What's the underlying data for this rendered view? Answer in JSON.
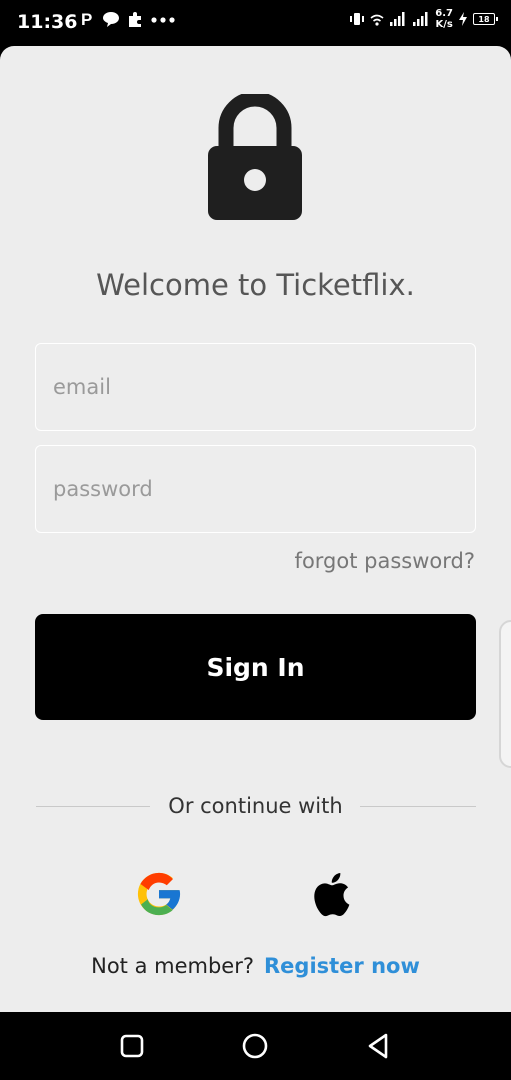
{
  "status_bar": {
    "time": "11:36",
    "left_icons": [
      "parking-icon",
      "chat-bubble-icon",
      "puzzle-icon",
      "more-dots-icon"
    ],
    "right_icons": [
      "vibrate-icon",
      "wifi-icon",
      "signal-icon",
      "signal-icon",
      "charging-icon"
    ],
    "net_speed_value": "6.7",
    "net_speed_unit": "K/s",
    "battery_level": "18"
  },
  "header": {
    "icon": "lock-icon",
    "welcome_text": "Welcome to Ticketflix."
  },
  "form": {
    "email_placeholder": "email",
    "email_value": "",
    "password_placeholder": "password",
    "password_value": "",
    "forgot_password_label": "forgot password?",
    "sign_in_label": "Sign In"
  },
  "social": {
    "continue_label": "Or continue with",
    "providers": [
      "google-icon",
      "apple-icon"
    ]
  },
  "footer": {
    "not_member_text": "Not a member?",
    "register_label": "Register now"
  },
  "nav_bar": {
    "buttons": [
      "recent-apps-icon",
      "home-icon",
      "back-icon"
    ]
  },
  "colors": {
    "background": "#ededed",
    "button": "#000000",
    "link": "#2f8fd8",
    "welcome_text": "#565656"
  }
}
